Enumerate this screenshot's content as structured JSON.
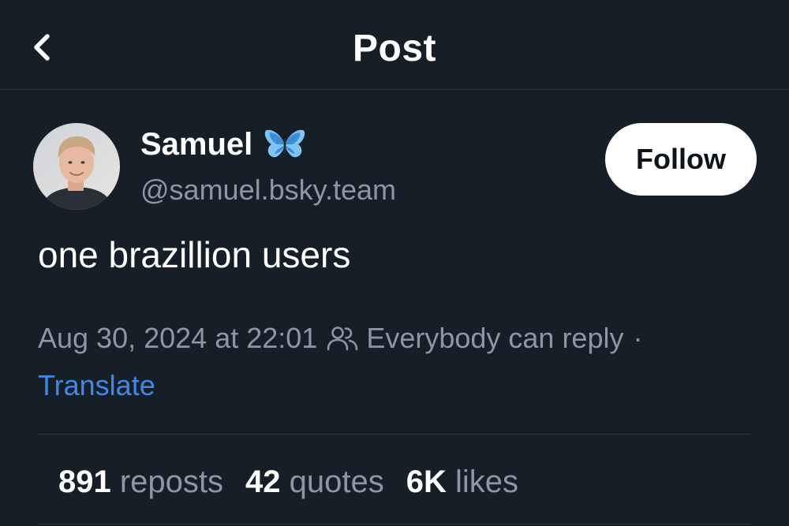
{
  "header": {
    "title": "Post",
    "back_icon": "chevron-left-icon"
  },
  "author": {
    "display_name": "Samuel",
    "badge_icon": "butterfly-icon",
    "handle": "@samuel.bsky.team"
  },
  "follow": {
    "label": "Follow"
  },
  "post": {
    "text": "one brazillion users",
    "timestamp": "Aug 30, 2024 at 22:01",
    "reply_icon": "people-icon",
    "reply_setting": "Everybody can reply",
    "separator": "·",
    "translate_label": "Translate"
  },
  "stats": {
    "reposts_count": "891",
    "reposts_label": "reposts",
    "quotes_count": "42",
    "quotes_label": "quotes",
    "likes_count": "6K",
    "likes_label": "likes"
  },
  "colors": {
    "background": "#161e27",
    "text_primary": "#ffffff",
    "text_secondary": "#8b97a6",
    "link": "#3f8ae6",
    "divider": "#2a3340",
    "follow_button_bg": "#ffffff"
  }
}
